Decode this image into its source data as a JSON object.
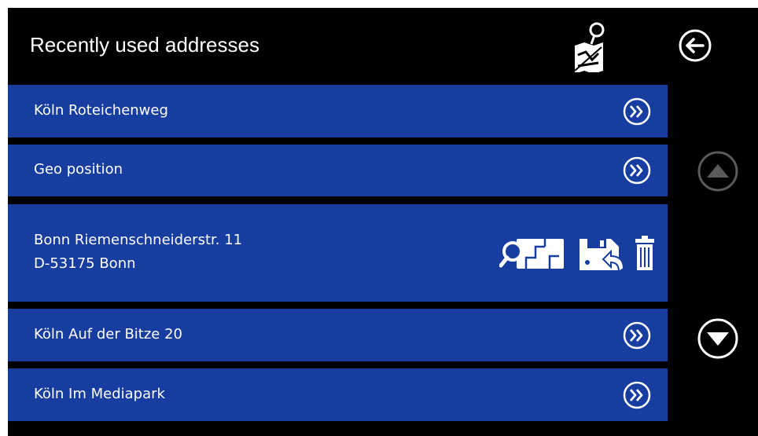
{
  "header": {
    "title": "Recently used addresses",
    "map_icon": "map-pin-edit-icon",
    "back_icon": "back-arrow-icon"
  },
  "addresses": [
    {
      "label": "Köln Roteichenweg",
      "icon": "double-chevron-right-icon"
    },
    {
      "label": "Geo position",
      "icon": "double-chevron-right-icon"
    },
    {
      "line1": "Bonn Riemenschneiderstr. 11",
      "line2": "D-53175 Bonn",
      "expanded": true,
      "actions": [
        "show-on-map-icon",
        "save-address-icon",
        "delete-trash-icon"
      ]
    },
    {
      "label": "Köln Auf der Bitze 20",
      "icon": "double-chevron-right-icon"
    },
    {
      "label": "Köln Im Mediapark",
      "icon": "double-chevron-right-icon"
    }
  ],
  "scroll": {
    "up_icon": "scroll-up-icon",
    "down_icon": "scroll-down-icon",
    "up_enabled": false
  },
  "colors": {
    "background": "#000000",
    "row": "#173da0",
    "text": "#ffffff",
    "disabled": "#5a5a5a"
  }
}
